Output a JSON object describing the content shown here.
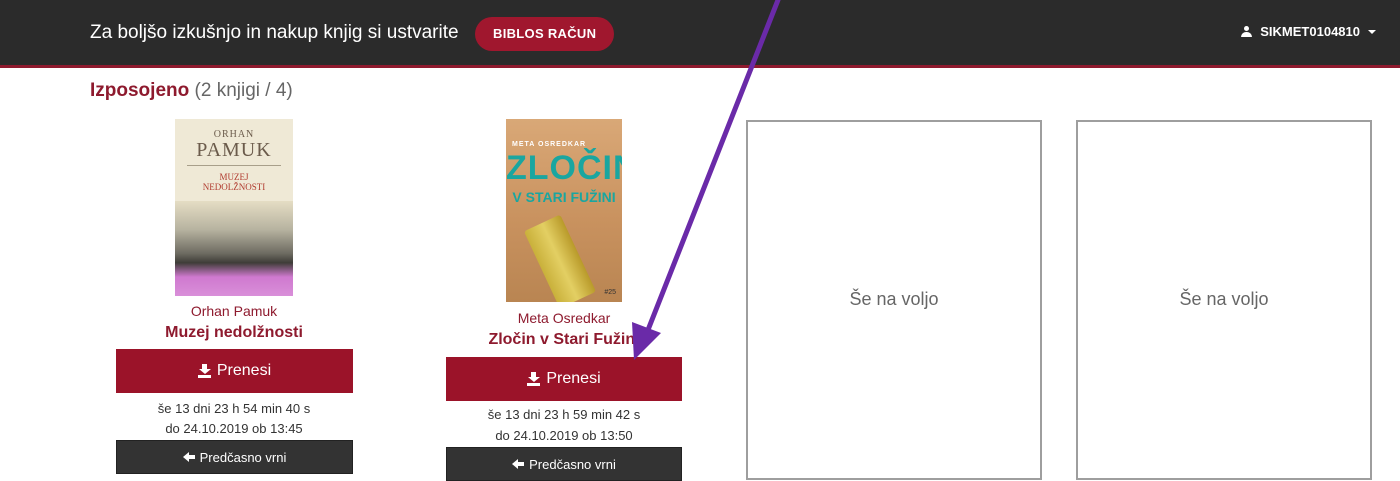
{
  "header": {
    "promo_text": "Za boljšo izkušnjo in nakup knjig si ustvarite",
    "account_button": "BIBLOS RAČUN",
    "username": "SIKMET0104810"
  },
  "borrowed": {
    "heading": "Izposojeno",
    "count": "(2 knjigi / 4)"
  },
  "books": [
    {
      "cover": {
        "author": "ORHAN",
        "name": "PAMUK",
        "title_line1": "MUZEJ",
        "title_line2": "NEDOLŽNOSTI"
      },
      "author": "Orhan Pamuk",
      "title": "Muzej nedolžnosti",
      "download_label": "Prenesi",
      "time_left": "še 13 dni 23 h 54 min 40 s",
      "due": "do 24.10.2019 ob 13:45",
      "return_label": "Predčasno vrni"
    },
    {
      "cover": {
        "author": "META OSREDKAR",
        "title_line1": "ZLOČIN",
        "title_line2": "V STARI FUŽINI",
        "publisher": "#25"
      },
      "author": "Meta Osredkar",
      "title": "Zločin v Stari Fužini",
      "download_label": "Prenesi",
      "time_left": "še 13 dni 23 h 59 min 42 s",
      "due": "do 24.10.2019 ob 13:50",
      "return_label": "Predčasno vrni"
    }
  ],
  "empty_slots": [
    "Še na voljo",
    "Še na voljo"
  ],
  "colors": {
    "brand": "#9b1329",
    "header_bg": "#2b2b2b",
    "annotation_arrow": "#6a2aa8"
  }
}
